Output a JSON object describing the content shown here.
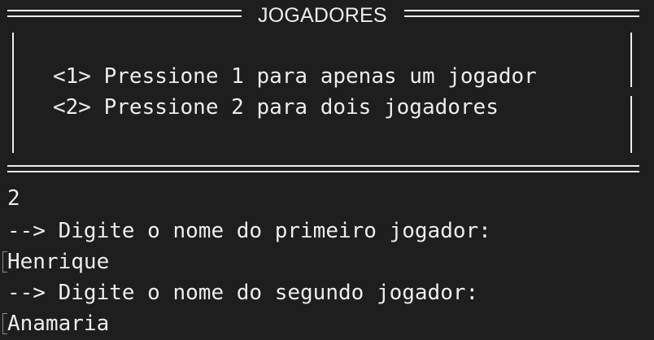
{
  "menu": {
    "title": "JOGADORES",
    "option_1": "<1> Pressione 1 para apenas um jogador",
    "option_2": "<2> Pressione 2 para dois jogadores"
  },
  "session": {
    "choice_input": "2",
    "prompt_first": "--> Digite o nome do primeiro jogador:",
    "first_player_name": "Henrique",
    "prompt_second": "--> Digite o nome do segundo jogador:",
    "second_player_name": "Anamaria"
  }
}
